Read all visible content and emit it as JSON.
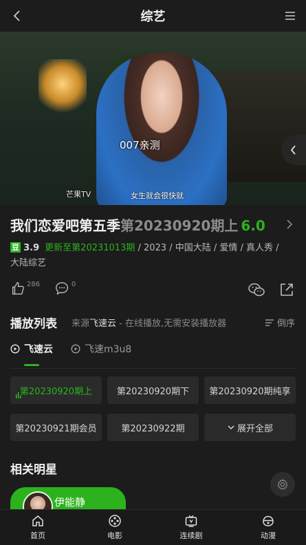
{
  "header": {
    "title": "综艺",
    "back_icon": "chevron-left-icon",
    "menu_icon": "hamburger-menu-icon"
  },
  "video": {
    "watermark": "007亲测",
    "caption": "女生就会很快就",
    "logo_text": "芒果TV"
  },
  "show": {
    "title": "我们恋爱吧第五季",
    "episode": "第20230920期上",
    "score": "6.0",
    "douban_badge": "豆",
    "douban_rating": "3.9",
    "update": "更新至第20231013期",
    "tags_line": "/ 2023 / 中国大陆 / 爱情 / 真人秀 /",
    "category": "大陆综艺"
  },
  "actions": {
    "likes": "286",
    "comments": "0"
  },
  "playlist": {
    "heading": "播放列表",
    "source_prefix": "来源",
    "source_name": "飞速云",
    "source_desc": " - 在线播放,无需安装播放器",
    "order_label": "倒序",
    "tabs": [
      {
        "label": "飞速云",
        "active": true
      },
      {
        "label": "飞速m3u8",
        "active": false
      }
    ],
    "episodes": [
      {
        "label": "第20230920期上",
        "active": true
      },
      {
        "label": "第20230920期下",
        "active": false
      },
      {
        "label": "第20230920期纯享",
        "active": false
      },
      {
        "label": "第20230921期会员",
        "active": false
      },
      {
        "label": "第20230922期",
        "active": false
      }
    ],
    "expand_label": "展开全部"
  },
  "stars": {
    "heading": "相关明星",
    "items": [
      {
        "name": "伊能静"
      }
    ]
  },
  "nav": [
    {
      "label": "首页",
      "icon": "home-icon"
    },
    {
      "label": "电影",
      "icon": "film-reel-icon"
    },
    {
      "label": "连续剧",
      "icon": "tv-icon"
    },
    {
      "label": "动漫",
      "icon": "anime-icon"
    }
  ],
  "colors": {
    "accent": "#2bb21c",
    "background": "#1c1c1c",
    "button": "#2a2a2a"
  }
}
